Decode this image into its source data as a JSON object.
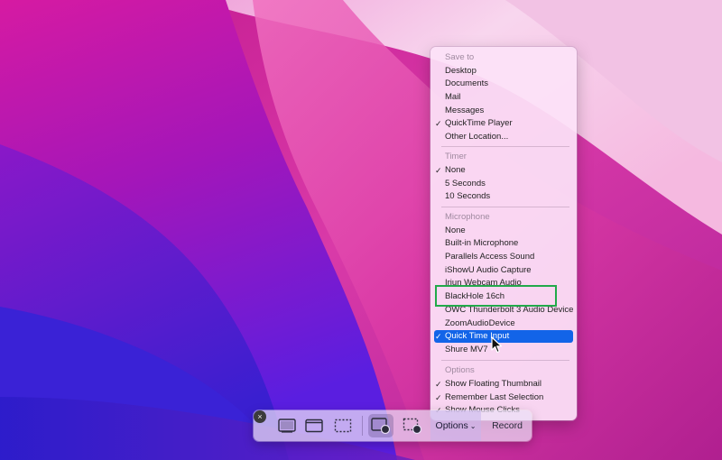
{
  "menu": {
    "groups": [
      {
        "header": "Save to",
        "items": [
          {
            "label": "Desktop",
            "checked": false
          },
          {
            "label": "Documents",
            "checked": false
          },
          {
            "label": "Mail",
            "checked": false
          },
          {
            "label": "Messages",
            "checked": false
          },
          {
            "label": "QuickTime Player",
            "checked": true
          },
          {
            "label": "Other Location...",
            "checked": false
          }
        ]
      },
      {
        "header": "Timer",
        "items": [
          {
            "label": "None",
            "checked": true
          },
          {
            "label": "5 Seconds",
            "checked": false
          },
          {
            "label": "10 Seconds",
            "checked": false
          }
        ]
      },
      {
        "header": "Microphone",
        "items": [
          {
            "label": "None",
            "checked": false
          },
          {
            "label": "Built-in Microphone",
            "checked": false
          },
          {
            "label": "Parallels Access Sound",
            "checked": false
          },
          {
            "label": "iShowU Audio Capture",
            "checked": false
          },
          {
            "label": "Iriun Webcam Audio",
            "checked": false
          },
          {
            "label": "BlackHole 16ch",
            "checked": false
          },
          {
            "label": "OWC Thunderbolt 3 Audio Device",
            "checked": false
          },
          {
            "label": "ZoomAudioDevice",
            "checked": false
          },
          {
            "label": "Quick Time Input",
            "checked": true,
            "selected": true
          },
          {
            "label": "Shure MV7",
            "checked": false
          }
        ]
      },
      {
        "header": "Options",
        "items": [
          {
            "label": "Show Floating Thumbnail",
            "checked": true
          },
          {
            "label": "Remember Last Selection",
            "checked": true
          },
          {
            "label": "Show Mouse Clicks",
            "checked": true
          }
        ]
      }
    ],
    "check_glyph": "✓",
    "highlight_color": "#1264e8",
    "annotation_color": "#22a94a"
  },
  "toolbar": {
    "close_icon": "close-icon",
    "close_glyph": "×",
    "buttons": [
      "capture-entire-screen-icon",
      "capture-window-icon",
      "capture-selection-icon",
      "record-entire-screen-icon",
      "record-selection-icon"
    ],
    "options_label": "Options",
    "options_chevron": "⌄",
    "record_label": "Record"
  },
  "colors": {
    "wallpaper_dark": "#3a1fd0",
    "wallpaper_magenta": "#d020a8",
    "wallpaper_light": "#f7c8ea"
  }
}
